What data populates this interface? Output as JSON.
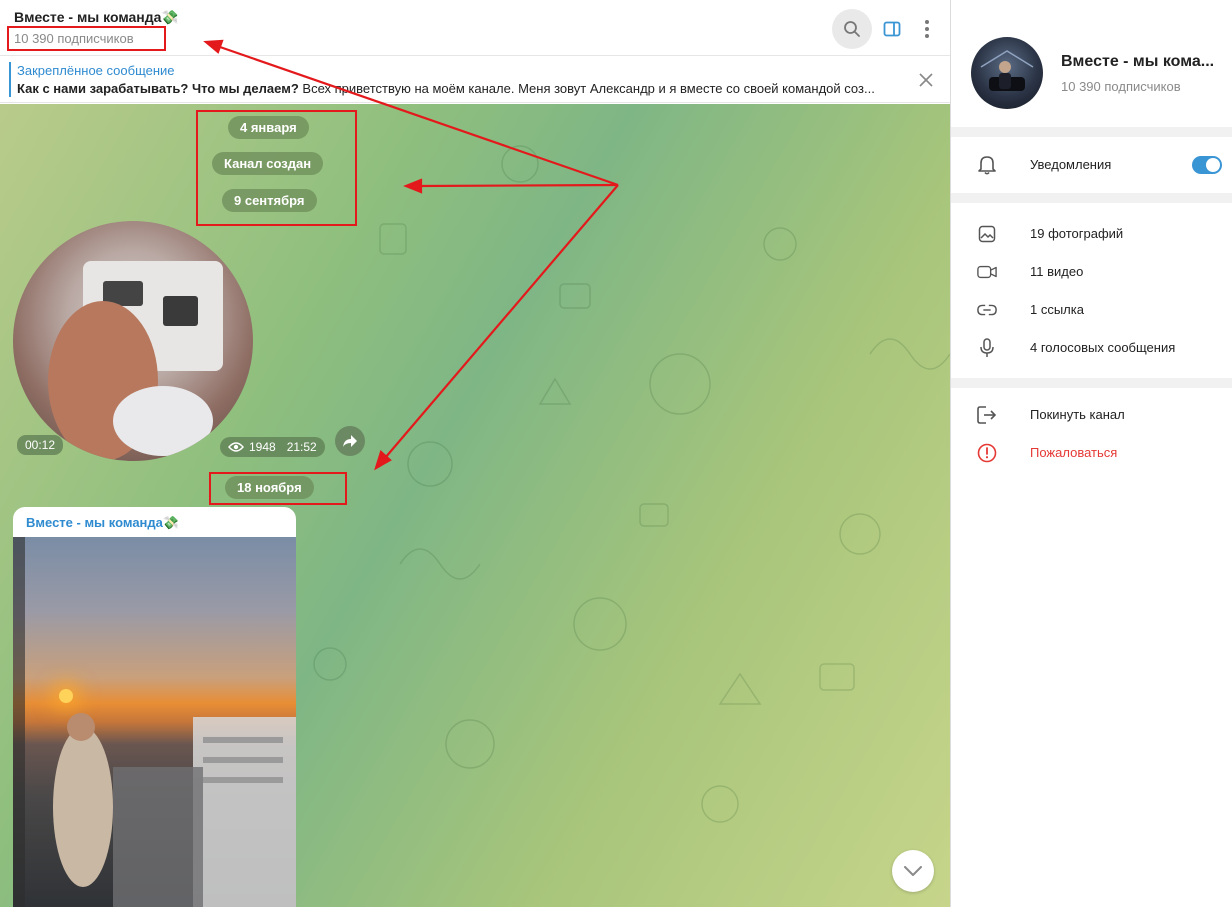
{
  "header": {
    "title": "Вместе - мы команда💸",
    "subscribers": "10 390 подписчиков",
    "search_icon": "search-icon",
    "sidebar_icon": "sidebar-toggle-icon",
    "more_icon": "more-vertical-icon"
  },
  "pinned": {
    "title": "Закреплённое сообщение",
    "bold_text": "Как с нами зарабатывать? Что мы делаем?",
    "text": " Всех приветствую на моём канале. Меня зовут Александр и  я вместе со своей командой соз..."
  },
  "chat": {
    "dates": [
      "4 января",
      "Канал создан",
      "9 сентября",
      "18 ноября"
    ],
    "video": {
      "duration": "00:12",
      "views": "1948",
      "time": "21:52"
    },
    "post": {
      "author": "Вместе - мы команда💸"
    }
  },
  "panel": {
    "name": "Вместе - мы кома...",
    "subscribers": "10 390 подписчиков",
    "notifications_label": "Уведомления",
    "notifications_on": true,
    "media": [
      {
        "icon": "photo-icon",
        "label": "19 фотографий"
      },
      {
        "icon": "video-icon",
        "label": "11 видео"
      },
      {
        "icon": "link-icon",
        "label": "1 ссылка"
      },
      {
        "icon": "microphone-icon",
        "label": "4 голосовых сообщения"
      }
    ],
    "actions": [
      {
        "icon": "leave-icon",
        "label": "Покинуть канал"
      },
      {
        "icon": "report-icon",
        "label": "Пожаловаться"
      }
    ]
  },
  "colors": {
    "accent": "#3a95d5",
    "annotation": "#e3191c",
    "danger": "#e53935"
  }
}
